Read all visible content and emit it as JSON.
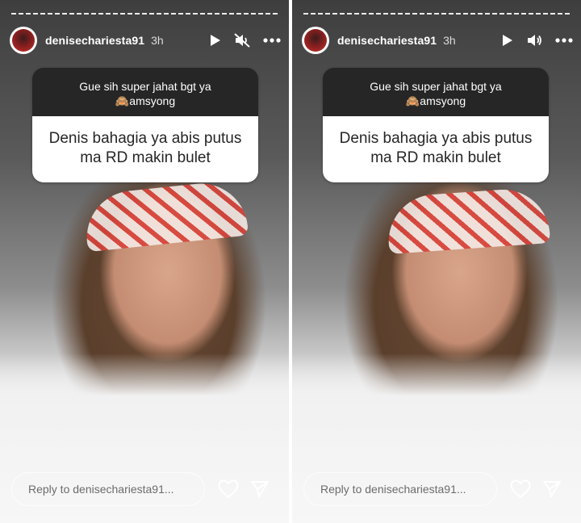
{
  "stories": [
    {
      "username": "denisechariesta91",
      "time": "3h",
      "sound_icon": "sound-muted-icon",
      "question": {
        "prompt": "Gue sih super jahat bgt ya",
        "prompt_sub": "🙈amsyong",
        "answer_line1": "Denis bahagia ya abis putus",
        "answer_line2": "ma RD makin bulet"
      },
      "reply_placeholder": "Reply to denisechariesta91..."
    },
    {
      "username": "denisechariesta91",
      "time": "3h",
      "sound_icon": "sound-on-icon",
      "question": {
        "prompt": "Gue sih super jahat bgt ya",
        "prompt_sub": "🙈amsyong",
        "answer_line1": "Denis bahagia ya abis putus",
        "answer_line2": "ma RD makin bulet"
      },
      "reply_placeholder": "Reply to denisechariesta91..."
    }
  ]
}
